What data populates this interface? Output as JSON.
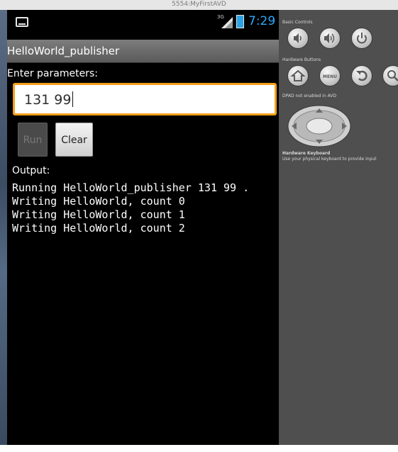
{
  "window": {
    "title": "5554:MyFirstAVD"
  },
  "status_bar": {
    "network": "3G",
    "time": "7:29"
  },
  "app": {
    "title": "HelloWorld_publisher",
    "params_label": "Enter parameters:",
    "params_value": "131  99",
    "run_label": "Run",
    "clear_label": "Clear",
    "output_label": "Output:",
    "output_lines": [
      "Running HelloWorld_publisher 131 99 .",
      "Writing HelloWorld, count 0",
      "Writing HelloWorld, count 1",
      "Writing HelloWorld, count 2"
    ]
  },
  "emulator_panel": {
    "basic_controls": "Basic Controls",
    "hardware_buttons": "Hardware Buttons",
    "menu_label": "MENU",
    "dpad_note": "DPAD not enabled in AVD",
    "keyboard_title": "Hardware Keyboard",
    "keyboard_note": "Use your physical keyboard to provide input"
  },
  "colors": {
    "focus_border": "#f59f1b",
    "time_blue": "#2aa9ff",
    "panel_bg": "#4f4f4f"
  }
}
